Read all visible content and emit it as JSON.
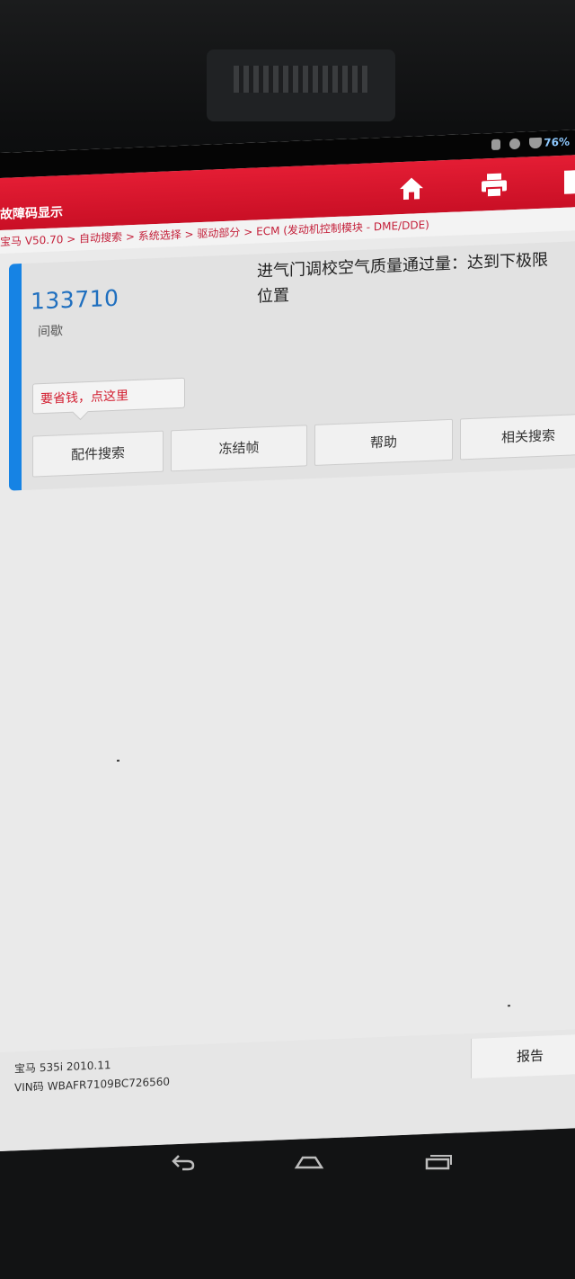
{
  "status_bar": {
    "battery_percent": "76%"
  },
  "header": {
    "title": "故障码显示",
    "icons": [
      "home-icon",
      "print-icon",
      "exit-icon"
    ]
  },
  "breadcrumb": {
    "text": "宝马 V50.70 > 自动搜索 > 系统选择 > 驱动部分 > ECM (发动机控制模块 - DME/DDE)"
  },
  "fault": {
    "code": "133710",
    "status": "间歇",
    "description_line1": "进气门调校空气质量通过量：达到下极限",
    "description_line2": "位置",
    "tip": "要省钱，点这里",
    "buttons": [
      "配件搜索",
      "冻结帧",
      "帮助",
      "相关搜索"
    ]
  },
  "footer": {
    "vehicle": "宝马 535i 2010.11",
    "vin_label": "VIN码",
    "vin_value": "WBAFR7109BC726560",
    "report_button": "报告"
  },
  "colors": {
    "header_red": "#d7142b",
    "accent_blue": "#1683e4",
    "code_blue": "#1f6fbf",
    "tip_red": "#d21d2f"
  },
  "nav_bar_icons": [
    "back-icon",
    "home-nav-icon",
    "recent-apps-icon"
  ]
}
